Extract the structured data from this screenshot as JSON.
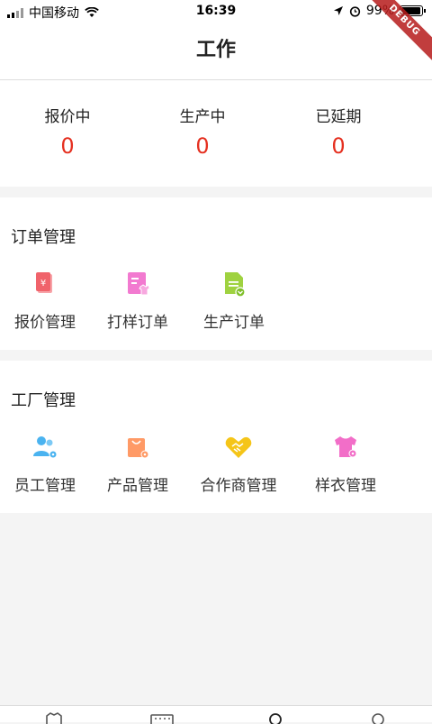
{
  "status_bar": {
    "carrier": "中国移动",
    "time": "16:39",
    "battery": "99%",
    "debug": "DEBUG"
  },
  "header": {
    "title": "工作"
  },
  "stats": [
    {
      "label": "报价中",
      "value": "0"
    },
    {
      "label": "生产中",
      "value": "0"
    },
    {
      "label": "已延期",
      "value": "0"
    }
  ],
  "order_section": {
    "title": "订单管理",
    "items": [
      {
        "label": "报价管理",
        "icon": "quote-doc-icon"
      },
      {
        "label": "打样订单",
        "icon": "sample-order-icon"
      },
      {
        "label": "生产订单",
        "icon": "production-order-icon"
      }
    ]
  },
  "factory_section": {
    "title": "工厂管理",
    "items": [
      {
        "label": "员工管理",
        "icon": "staff-icon"
      },
      {
        "label": "产品管理",
        "icon": "product-bag-icon"
      },
      {
        "label": "合作商管理",
        "icon": "partner-handshake-icon"
      },
      {
        "label": "样衣管理",
        "icon": "sample-shirt-icon"
      }
    ]
  },
  "colors": {
    "accent_red": "#e53020",
    "quote": "#f0636b",
    "sample": "#f27ad0",
    "production": "#9fd240",
    "staff": "#4ab3f0",
    "product": "#ff9a66",
    "partner": "#f5c518",
    "shirt": "#f26ec8"
  }
}
